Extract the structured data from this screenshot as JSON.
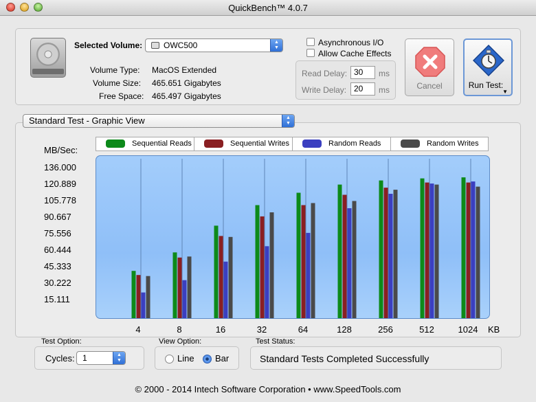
{
  "window": {
    "title": "QuickBench™ 4.0.7"
  },
  "volume": {
    "selected_label": "Selected Volume:",
    "selected_value": "OWC500",
    "type_label": "Volume Type:",
    "type_value": "MacOS Extended",
    "size_label": "Volume Size:",
    "size_value": "465.651 Gigabytes",
    "free_label": "Free Space:",
    "free_value": "465.497 Gigabytes"
  },
  "options": {
    "async_label": "Asynchronous I/O",
    "async_checked": false,
    "cache_label": "Allow Cache Effects",
    "cache_checked": false,
    "read_delay_label": "Read Delay:",
    "read_delay_value": "30",
    "read_delay_unit": "ms",
    "write_delay_label": "Write Delay:",
    "write_delay_value": "20",
    "write_delay_unit": "ms"
  },
  "buttons": {
    "cancel_label": "Cancel",
    "run_label": "Run Test"
  },
  "test_view": {
    "selected": "Standard Test - Graphic View"
  },
  "chart_data": {
    "type": "bar",
    "ylabel": "MB/Sec:",
    "xunit": "KB",
    "categories": [
      "4",
      "8",
      "16",
      "32",
      "64",
      "128",
      "256",
      "512",
      "1024"
    ],
    "ytick_labels": [
      "136.000",
      "120.889",
      "105.778",
      "90.667",
      "75.556",
      "60.444",
      "45.333",
      "30.222",
      "15.111"
    ],
    "ylim": [
      0,
      151.111
    ],
    "series": [
      {
        "name": "Sequential Reads",
        "color": "#0d8a1a",
        "values": [
          46,
          64,
          90,
          110,
          122,
          130,
          134,
          136,
          137
        ]
      },
      {
        "name": "Sequential Writes",
        "color": "#8a1f22",
        "values": [
          42,
          59,
          80,
          99,
          110,
          120,
          127,
          132,
          132
        ]
      },
      {
        "name": "Random Reads",
        "color": "#3b3fc0",
        "values": [
          25,
          37,
          55,
          70,
          83,
          107,
          121,
          131,
          133
        ]
      },
      {
        "name": "Random Writes",
        "color": "#4a4a4a",
        "values": [
          41,
          60,
          79,
          103,
          112,
          114,
          125,
          130,
          128
        ]
      }
    ],
    "grid": true
  },
  "bottom": {
    "test_option_label": "Test Option:",
    "cycles_label": "Cycles:",
    "cycles_value": "1",
    "view_option_label": "View Option:",
    "view_line": "Line",
    "view_bar": "Bar",
    "view_selected": "Bar",
    "status_label": "Test Status:",
    "status_value": "Standard Tests Completed Successfully"
  },
  "footer": {
    "text": "© 2000 - 2014 Intech Software Corporation • www.SpeedTools.com"
  }
}
